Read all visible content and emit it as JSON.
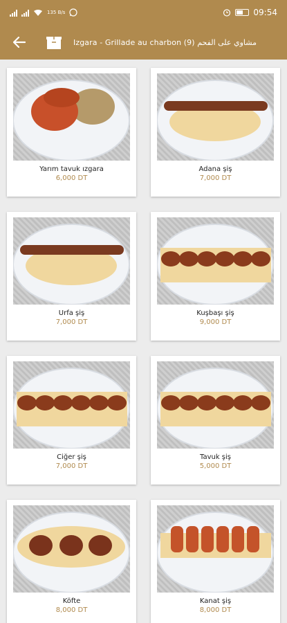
{
  "status": {
    "time": "09:54",
    "net": "135 B/s"
  },
  "header": {
    "title": "Izgara - Grillade au charbon (9) مشاوي على الفحم"
  },
  "products": [
    {
      "name": "Yarım tavuk ızgara",
      "price": "6,000 DT",
      "dish": "rice"
    },
    {
      "name": "Adana şiş",
      "price": "7,000 DT",
      "dish": "kebab"
    },
    {
      "name": "Urfa şiş",
      "price": "7,000 DT",
      "dish": "kebab"
    },
    {
      "name": "Kuşbaşı şiş",
      "price": "9,000 DT",
      "dish": "chunks"
    },
    {
      "name": "Ciğer şiş",
      "price": "7,000 DT",
      "dish": "chunks"
    },
    {
      "name": "Tavuk şiş",
      "price": "5,000 DT",
      "dish": "chunks"
    },
    {
      "name": "Köfte",
      "price": "8,000 DT",
      "dish": "kofte"
    },
    {
      "name": "Kanat şiş",
      "price": "8,000 DT",
      "dish": "wings"
    }
  ]
}
